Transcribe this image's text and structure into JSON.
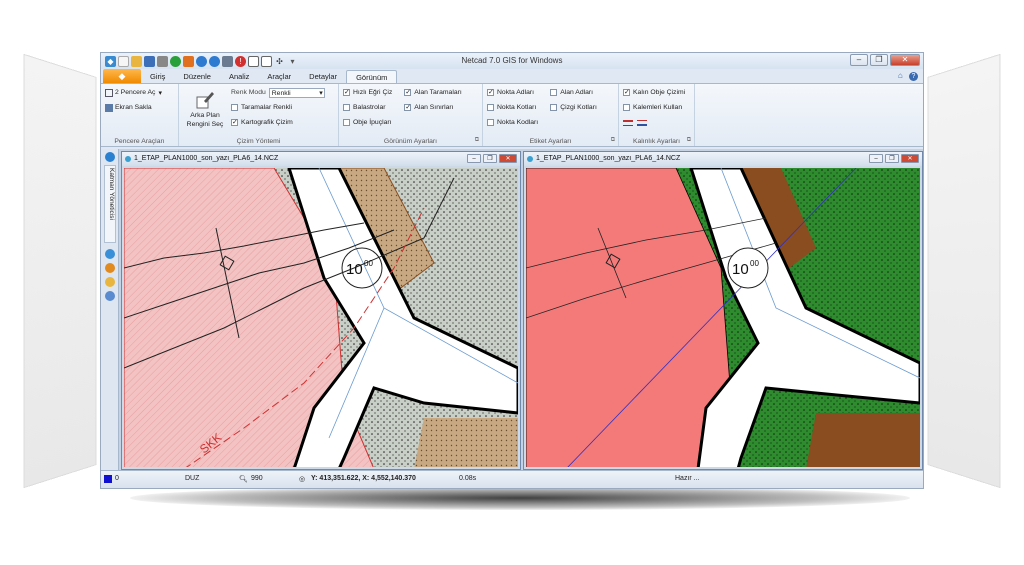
{
  "app": {
    "title": "Netcad 7.0 GIS for Windows"
  },
  "window_controls": {
    "minimize": "–",
    "restore": "❐",
    "close": "✕"
  },
  "tabs": [
    {
      "label": "Giriş"
    },
    {
      "label": "Düzenle"
    },
    {
      "label": "Analiz"
    },
    {
      "label": "Araçlar"
    },
    {
      "label": "Detaylar"
    },
    {
      "label": "Görünüm"
    }
  ],
  "active_tab": "Görünüm",
  "ribbon": {
    "pencere": {
      "label": "Pencere Araçları",
      "split_windows": "2 Pencere Aç",
      "save_screen": "Ekran Sakla"
    },
    "cizim": {
      "label": "Çizim Yöntemi",
      "bg_color_button": "Arka Plan Rengini Seç",
      "color_mode_label": "Renk Modu",
      "color_mode_value": "Renkli",
      "hatch_colored": "Taramalar Renkli",
      "cartographic": "Kartografik Çizim"
    },
    "gorunum": {
      "label": "Görünüm Ayarları",
      "fast_curve": "Hızlı Eğri Çiz",
      "balast": "Balastrolar",
      "obj_hints": "Obje İpuçları",
      "area_hatch": "Alan Taramaları",
      "area_bounds": "Alan Sınırları"
    },
    "etiket": {
      "label": "Etiket Ayarları",
      "point_names": "Nokta Adları",
      "point_elev": "Nokta Kotları",
      "point_codes": "Nokta Kodları",
      "area_names": "Alan Adları",
      "line_elev": "Çizgi Kotları"
    },
    "kalinlik": {
      "label": "Kalınlık Ayarları",
      "bold_objects": "Kalın Obje Çizimi",
      "use_pens": "Kalemleri Kullan"
    }
  },
  "side_toolbar": {
    "layer_manager": "Katman Yöneticisi"
  },
  "map_windows": [
    {
      "title": "1_ETAP_PLAN1000_son_yazı_PLA6_14.NCZ",
      "label_main": "10",
      "label_sup": "00",
      "text_skk": "SKK"
    },
    {
      "title": "1_ETAP_PLAN1000_son_yazı_PLA6_14.NCZ",
      "label_main": "10",
      "label_sup": "00"
    }
  ],
  "statusbar": {
    "layer": "0",
    "mode": "DUZ",
    "zoom": "990",
    "coords": "Y: 413,351.622, X: 4,552,140.370",
    "time": "0.08s",
    "status": "Hazır ..."
  },
  "colors": {
    "ribbon_bg": "#e3ebf5",
    "app_button": "#f08a00",
    "parcel_pink_hatched": "#f3c2c2",
    "parcel_red": "#f47a7a",
    "parcel_brown": "#8a4d1f",
    "parcel_tan": "#c7a882",
    "green_area": "#2e8b2e",
    "grey_dotted": "#c8cfc6",
    "road": "#ffffff"
  }
}
